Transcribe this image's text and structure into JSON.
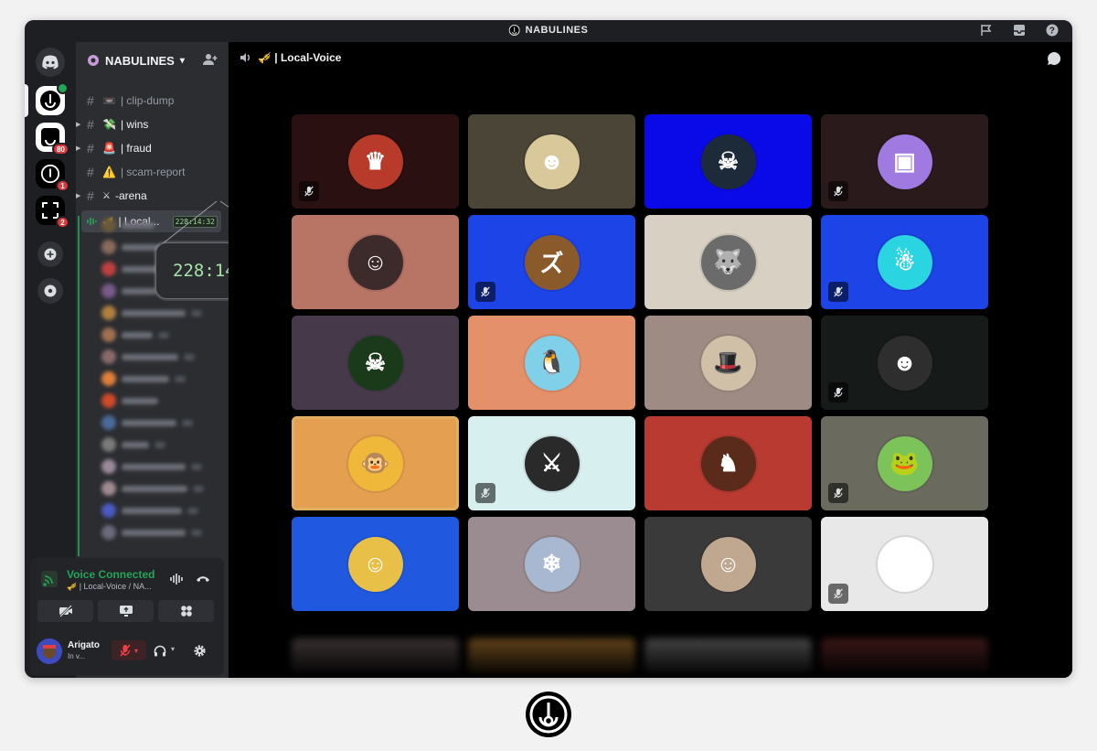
{
  "window": {
    "title": "NABULINES"
  },
  "rail": {
    "badges": [
      "80",
      "1",
      "2"
    ]
  },
  "guild": {
    "name": "NABULINES",
    "chevron": "▾"
  },
  "channels": [
    {
      "emoji": "📼",
      "name": "| clip-dump"
    },
    {
      "emoji": "💸",
      "name": "| wins"
    },
    {
      "emoji": "🚨",
      "name": "| fraud"
    },
    {
      "emoji": "⚠️",
      "name": "| scam-report"
    },
    {
      "emoji": "⚔",
      "name": "-arena"
    }
  ],
  "voice_channel": {
    "emoji": "🎺",
    "name": "| Local...",
    "timer": "228:14:32"
  },
  "callout": {
    "timer": "228:14:32"
  },
  "voice_panel": {
    "status": "Voice Connected",
    "channel": "🎺 | Local-Voice / NA...",
    "user": {
      "name": "Arigato",
      "status": "In v..."
    }
  },
  "main": {
    "channel_title": "🎺 | Local-Voice"
  },
  "tiles": [
    {
      "bg": "#2a1010",
      "color": "#b83a2a",
      "glyph": "♛",
      "muted": true
    },
    {
      "bg": "#4a4536",
      "color": "#d8c89a",
      "glyph": "☻",
      "muted": false
    },
    {
      "bg": "#0a0ae8",
      "color": "#1c2a3a",
      "glyph": "☠",
      "muted": false
    },
    {
      "bg": "#2a1a1c",
      "color": "#a07ae0",
      "glyph": "▣",
      "muted": true
    },
    {
      "bg": "#b87566",
      "color": "#3d2a2a",
      "glyph": "☺",
      "muted": false
    },
    {
      "bg": "#1d44e6",
      "color": "#8b5a2b",
      "glyph": "ズ",
      "muted": true
    },
    {
      "bg": "#d9d0c4",
      "color": "#6b6b6b",
      "glyph": "🐺",
      "muted": false
    },
    {
      "bg": "#1d44e6",
      "color": "#2ad4e0",
      "glyph": "☃",
      "muted": true
    },
    {
      "bg": "#463a4a",
      "color": "#1a3a1a",
      "glyph": "☠",
      "muted": false
    },
    {
      "bg": "#e4906a",
      "color": "#7fd0e8",
      "glyph": "🐧",
      "muted": false
    },
    {
      "bg": "#9e8c84",
      "color": "#d0c0a8",
      "glyph": "🎩",
      "muted": false
    },
    {
      "bg": "#161a18",
      "color": "#2e2e2e",
      "glyph": "☻",
      "muted": true
    },
    {
      "bg": "#e4a050",
      "color": "#f0b83a",
      "glyph": "🐵",
      "muted": false,
      "speaking": true
    },
    {
      "bg": "#d8eff0",
      "color": "#2a2a2a",
      "glyph": "⚔",
      "muted": true
    },
    {
      "bg": "#b83a30",
      "color": "#5a2a1a",
      "glyph": "♞",
      "muted": false
    },
    {
      "bg": "#6a6a5e",
      "color": "#7cc45a",
      "glyph": "🐸",
      "muted": true
    },
    {
      "bg": "#2058e0",
      "color": "#e8c048",
      "glyph": "☺",
      "muted": false
    },
    {
      "bg": "#9a8c90",
      "color": "#a8b8d0",
      "glyph": "❄",
      "muted": false
    },
    {
      "bg": "#3a3a3a",
      "color": "#c0a890",
      "glyph": "☺",
      "muted": false
    },
    {
      "bg": "#e8e8e8",
      "color": "#ffffff",
      "glyph": "☺",
      "muted": true
    }
  ],
  "colors": {
    "accent_green": "#23a559",
    "badge_red": "#da373c",
    "blurple": "#5865f2"
  }
}
